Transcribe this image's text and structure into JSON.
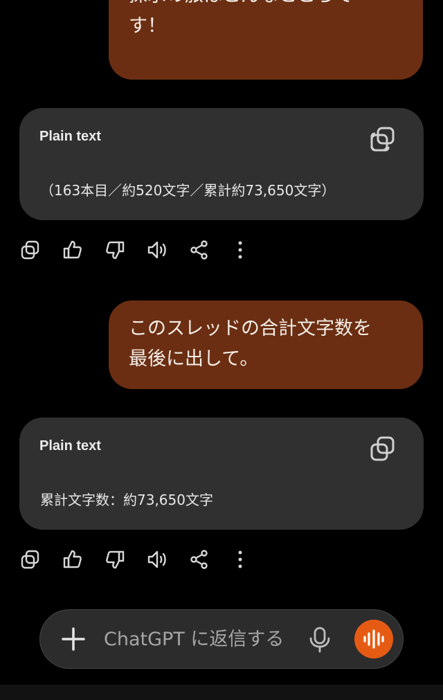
{
  "colors": {
    "background": "#000000",
    "user_bubble": "#6b2e12",
    "code_card": "#303030",
    "composer": "#2c2c2c",
    "voice_button": "#e65b14"
  },
  "messages": [
    {
      "role": "user",
      "lines": [
        "",
        "探求の旅はこんなところで",
        "す！"
      ]
    },
    {
      "role": "assistant",
      "code_language": "Plain text",
      "code_text": "（163本目／約520文字／累計約73,650文字）",
      "copy_icon": "copy-icon",
      "actions": [
        "copy-icon",
        "thumbs-up-icon",
        "thumbs-down-icon",
        "read-aloud-icon",
        "share-icon",
        "more-icon"
      ]
    },
    {
      "role": "user",
      "lines": [
        "このスレッドの合計文字数を",
        "最後に出して。"
      ]
    },
    {
      "role": "assistant",
      "code_language": "Plain text",
      "code_text": "累計文字数：約73,650文字",
      "copy_icon": "copy-icon",
      "actions": [
        "copy-icon",
        "thumbs-up-icon",
        "thumbs-down-icon",
        "read-aloud-icon",
        "share-icon",
        "more-icon"
      ]
    }
  ],
  "composer": {
    "placeholder": "ChatGPT に返信する",
    "value": "",
    "icons": [
      "plus-icon",
      "microphone-icon",
      "voice-waveform-icon"
    ]
  }
}
